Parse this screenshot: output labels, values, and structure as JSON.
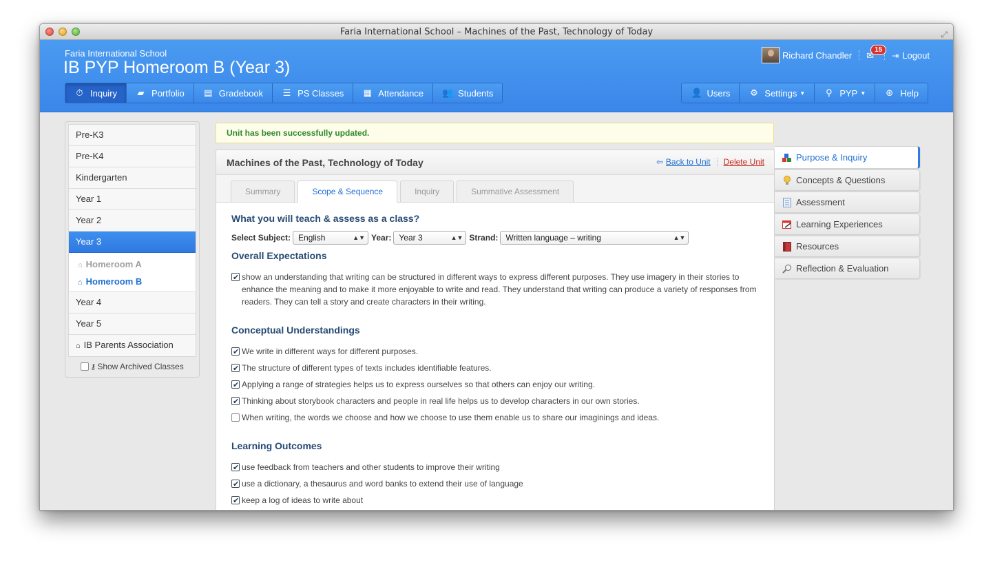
{
  "window": {
    "title": "Faria International School – Machines of the Past, Technology of Today"
  },
  "header": {
    "school": "Faria International School",
    "class_title": "IB PYP Homeroom B (Year 3)",
    "user_name": "Richard Chandler",
    "mail_count": "15",
    "logout": "Logout"
  },
  "nav_left": [
    {
      "label": "Inquiry",
      "icon": "stopwatch-icon"
    },
    {
      "label": "Portfolio",
      "icon": "briefcase-icon"
    },
    {
      "label": "Gradebook",
      "icon": "notebook-icon"
    },
    {
      "label": "PS Classes",
      "icon": "list-icon"
    },
    {
      "label": "Attendance",
      "icon": "calendar-icon"
    },
    {
      "label": "Students",
      "icon": "users-icon"
    }
  ],
  "nav_right": [
    {
      "label": "Users",
      "icon": "user-icon"
    },
    {
      "label": "Settings",
      "icon": "gear-icon"
    },
    {
      "label": "PYP",
      "icon": "search-icon"
    },
    {
      "label": "Help",
      "icon": "lifebuoy-icon"
    }
  ],
  "sidebar": {
    "items": [
      "Pre-K3",
      "Pre-K4",
      "Kindergarten",
      "Year 1",
      "Year 2",
      "Year 3",
      "Year 4",
      "Year 5",
      "IB Parents Association"
    ],
    "sub_items": [
      "Homeroom A",
      "Homeroom B"
    ],
    "show_archived": "Show Archived Classes"
  },
  "alert": "Unit has been successfully updated.",
  "unit": {
    "title": "Machines of the Past, Technology of Today",
    "back_link": "Back to Unit",
    "delete_link": "Delete Unit"
  },
  "tabs": [
    "Summary",
    "Scope & Sequence",
    "Inquiry",
    "Summative Assessment"
  ],
  "scope": {
    "heading": "What you will teach & assess as a class?",
    "subject_label": "Select Subject:",
    "subject_value": "English",
    "year_label": "Year:",
    "year_value": "Year 3",
    "strand_label": "Strand:",
    "strand_value": "Written language – writing",
    "overall_heading": "Overall Expectations",
    "overall_text": "show an understanding that writing can be structured in different ways to express different purposes. They use imagery in their stories to enhance the meaning and to make it more enjoyable to write and read. They understand that writing can produce a variety of responses from readers. They can tell a story and create characters in their writing.",
    "conceptual_heading": "Conceptual Understandings",
    "conceptual": [
      {
        "text": "We write in different ways for different purposes.",
        "checked": true
      },
      {
        "text": "The structure of different types of texts includes identifiable features.",
        "checked": true
      },
      {
        "text": "Applying a range of strategies helps us to express ourselves so that others can enjoy our writing.",
        "checked": true
      },
      {
        "text": "Thinking about storybook characters and people in real life helps us to develop characters in our own stories.",
        "checked": true
      },
      {
        "text": "When writing, the words we choose and how we choose to use them enable us to share our imaginings and ideas.",
        "checked": false
      }
    ],
    "outcomes_heading": "Learning Outcomes",
    "outcomes": [
      {
        "text": "use feedback from teachers and other students to improve their writing",
        "checked": true
      },
      {
        "text": "use a dictionary, a thesaurus and word banks to extend their use of language",
        "checked": true
      },
      {
        "text": "keep a log of ideas to write about",
        "checked": true
      }
    ]
  },
  "right_menu": [
    "Purpose & Inquiry",
    "Concepts & Questions",
    "Assessment",
    "Learning Experiences",
    "Resources",
    "Reflection & Evaluation"
  ]
}
